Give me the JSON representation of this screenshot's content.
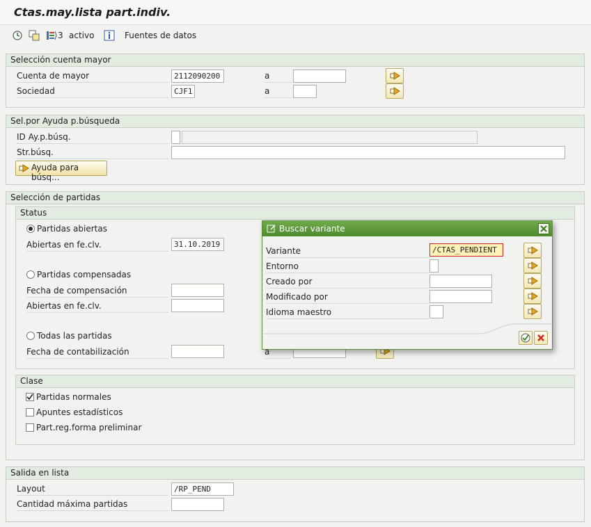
{
  "title": "Ctas.may.lista part.indiv.",
  "toolbar": {
    "count_value": "3",
    "count_label": "activo",
    "data_sources_label": "Fuentes de datos"
  },
  "sel_cuenta": {
    "header": "Selección cuenta mayor",
    "cuenta_label": "Cuenta de mayor",
    "cuenta_value": "2112090200",
    "sociedad_label": "Sociedad",
    "sociedad_value": "CJF1",
    "a_label": "a"
  },
  "sel_ayuda": {
    "header": "Sel.por Ayuda p.búsqueda",
    "id_label": "ID Ay.p.búsq.",
    "str_label": "Str.búsq.",
    "button_label": "Ayuda para búsq..."
  },
  "sel_partidas": {
    "header": "Selección de partidas",
    "status_header": "Status",
    "abiertas_radio": "Partidas abiertas",
    "abiertas_fecha_label": "Abiertas en fe.clv.",
    "abiertas_fecha_value": "31.10.2019",
    "compensadas_radio": "Partidas compensadas",
    "fecha_comp_label": "Fecha de compensación",
    "abiertas_fecha2_label": "Abiertas en fe.clv.",
    "todas_radio": "Todas las partidas",
    "fecha_cont_label": "Fecha de contabilización",
    "a_label": "a",
    "clase_header": "Clase",
    "normales_label": "Partidas normales",
    "normales_checked": true,
    "estadisticos_label": "Apuntes estadísticos",
    "preliminar_label": "Part.reg.forma preliminar"
  },
  "salida": {
    "header": "Salida en lista",
    "layout_label": "Layout",
    "layout_value": "/RP_PEND",
    "cantidad_label": "Cantidad máxima partidas"
  },
  "dialog": {
    "title": "Buscar variante",
    "variante_label": "Variante",
    "variante_value": "/CTAS_PENDIENT",
    "entorno_label": "Entorno",
    "creado_label": "Creado por",
    "modificado_label": "Modificado por",
    "idioma_label": "Idioma maestro"
  },
  "colors": {
    "dialog_header": "#5d9a3a",
    "group_header": "#e3ece0",
    "highlight_field": "#fff3b8"
  }
}
